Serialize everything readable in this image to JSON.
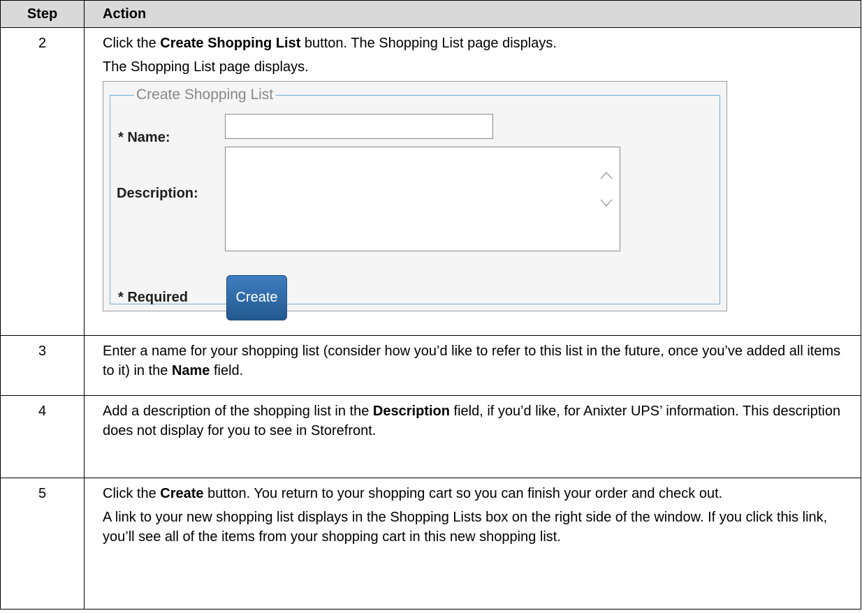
{
  "table": {
    "header": {
      "step": "Step",
      "action": "Action"
    },
    "rows": [
      {
        "step": "2",
        "p1": {
          "pre": "Click the ",
          "bold": "Create Shopping List",
          "post": " button. The Shopping List page displays."
        },
        "p2": "The Shopping List page displays."
      },
      {
        "step": "3",
        "p1": {
          "pre": "Enter a name for your shopping list (consider how you’d like to refer to this list in the future, once you’ve added all items to it) in the ",
          "bold": "Name",
          "post": " field."
        }
      },
      {
        "step": "4",
        "p1": {
          "pre": "Add a description of the shopping list in the ",
          "bold": "Description",
          "post": " field, if you’d like, for Anixter UPS’ information. This description does not display for you to see in Storefront."
        }
      },
      {
        "step": "5",
        "p1": {
          "pre": "Click the ",
          "bold": "Create",
          "post": " button. You return to your shopping cart so you can finish your order and check out."
        },
        "p2": "A link to your new shopping list displays in the Shopping Lists box on the right side of the window. If you click this link, you’ll see all of the items from your shopping cart in this new shopping list."
      }
    ]
  },
  "form": {
    "legend": "Create Shopping List",
    "name_label": "* Name:",
    "name_value": "",
    "description_label": "Description:",
    "description_value": "",
    "required_label": "* Required",
    "create_button": "Create",
    "accent_color": "#2c6aa8",
    "icons": [
      "scroll-up-icon",
      "scroll-down-icon"
    ]
  }
}
